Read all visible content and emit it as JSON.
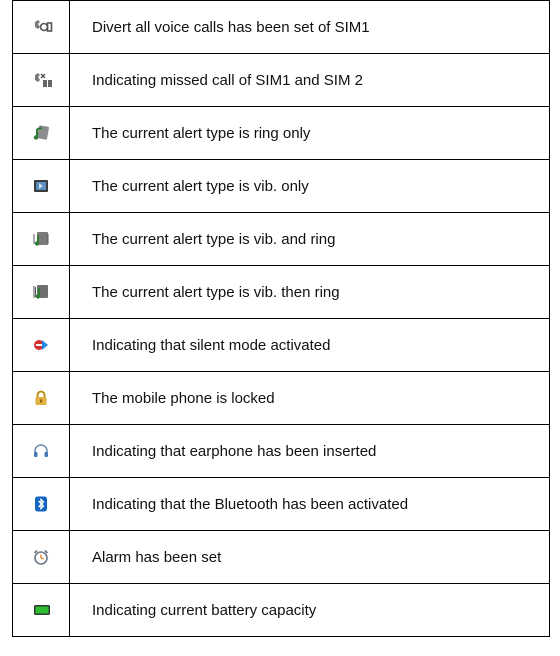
{
  "rows": [
    {
      "icon": "divert-calls-icon",
      "text": "Divert all voice calls has been set of SIM1"
    },
    {
      "icon": "missed-call-icon",
      "text": "Indicating missed call of SIM1 and SIM 2"
    },
    {
      "icon": "ring-only-icon",
      "text": "The current alert type is ring only"
    },
    {
      "icon": "vibrate-only-icon",
      "text": "The current alert type is vib. only"
    },
    {
      "icon": "vib-and-ring-icon",
      "text": "The current alert type is vib. and ring"
    },
    {
      "icon": "vib-then-ring-icon",
      "text": "The current alert type is vib. then ring"
    },
    {
      "icon": "silent-mode-icon",
      "text": "Indicating that silent mode activated"
    },
    {
      "icon": "lock-icon",
      "text": "The mobile phone is locked"
    },
    {
      "icon": "earphone-icon",
      "text": "Indicating that earphone has been inserted"
    },
    {
      "icon": "bluetooth-icon",
      "text": "Indicating that the Bluetooth has been activated"
    },
    {
      "icon": "alarm-clock-icon",
      "text": "Alarm has been set"
    },
    {
      "icon": "battery-icon",
      "text": "Indicating current battery capacity"
    }
  ]
}
